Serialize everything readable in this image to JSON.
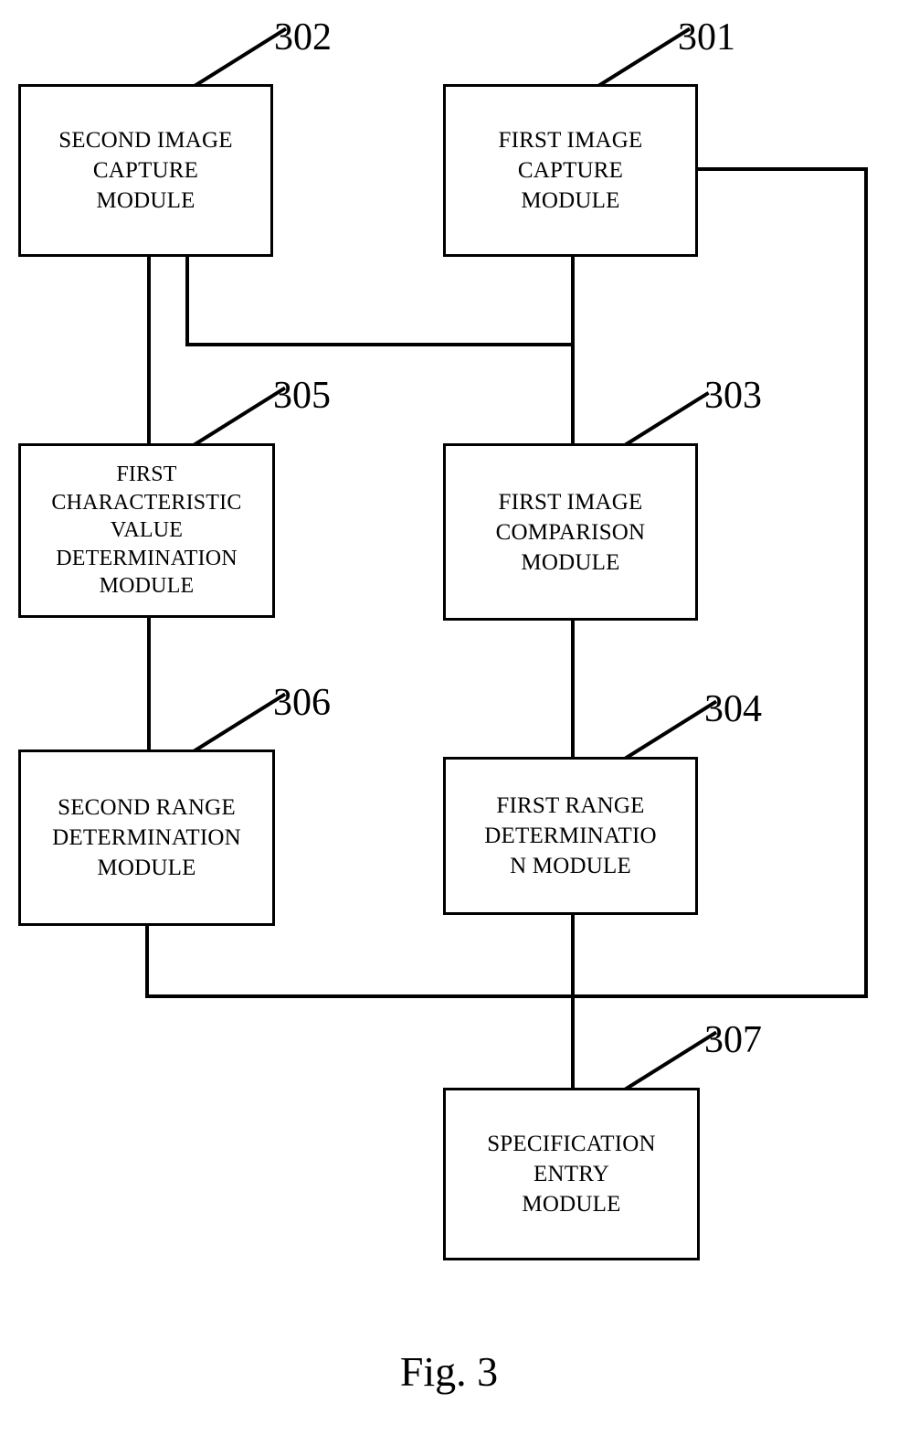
{
  "figure": {
    "caption": "Fig. 3",
    "type": "patent-block-diagram"
  },
  "boxes": [
    {
      "ref": "302",
      "label": "SECOND IMAGE\nCAPTURE\nMODULE",
      "name": "second-image-capture-module"
    },
    {
      "ref": "301",
      "label": "FIRST IMAGE\nCAPTURE\nMODULE",
      "name": "first-image-capture-module"
    },
    {
      "ref": "305",
      "label": "FIRST\nCHARACTERISTIC\nVALUE\nDETERMINATION\nMODULE",
      "name": "first-characteristic-value-determination-module"
    },
    {
      "ref": "303",
      "label": "FIRST IMAGE\nCOMPARISON\nMODULE",
      "name": "first-image-comparison-module"
    },
    {
      "ref": "306",
      "label": "SECOND RANGE\nDETERMINATION\nMODULE",
      "name": "second-range-determination-module"
    },
    {
      "ref": "304",
      "label": "FIRST RANGE\nDETERMINATIO\nN MODULE",
      "name": "first-range-determination-module"
    },
    {
      "ref": "307",
      "label": "SPECIFICATION\nENTRY\nMODULE",
      "name": "specification-entry-module"
    }
  ],
  "reference_numerals": [
    "302",
    "301",
    "305",
    "303",
    "306",
    "304",
    "307"
  ],
  "colors": {
    "line": "#000000",
    "background": "#ffffff",
    "text": "#000000"
  }
}
